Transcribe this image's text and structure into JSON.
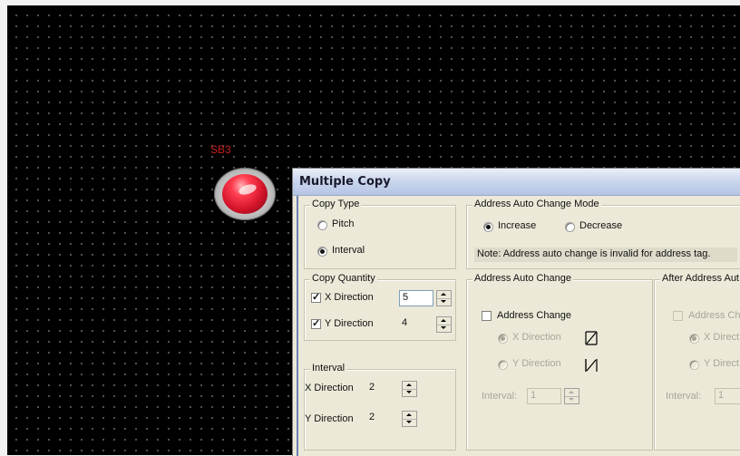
{
  "canvas": {
    "tag_label": "SB3"
  },
  "dialog": {
    "title": "Multiple Copy",
    "copy_type": {
      "legend": "Copy Type",
      "options": [
        "Pitch",
        "Interval"
      ],
      "selected": "Interval"
    },
    "copy_quantity": {
      "legend": "Copy Quantity",
      "x_label": "X Direction",
      "x_checked": true,
      "x_value": "5",
      "y_label": "Y Direction",
      "y_checked": true,
      "y_value": "4"
    },
    "interval": {
      "legend": "Interval",
      "x_label": "X Direction",
      "x_value": "2",
      "y_label": "Y Direction",
      "y_value": "2"
    },
    "address_mode": {
      "legend": "Address Auto Change Mode",
      "options": [
        "Increase",
        "Decrease"
      ],
      "selected": "Increase",
      "note": "Note: Address auto change is invalid for address tag."
    },
    "address_change": {
      "legend": "Address Auto Change",
      "checkbox_label": "Address Change",
      "checked": false,
      "x_option": "X Direction",
      "y_option": "Y Direction",
      "selected": "X Direction",
      "interval_label": "Interval:",
      "interval_value": "1"
    },
    "after_address": {
      "legend": "After Address Aut",
      "checkbox_label": "Address Cha",
      "x_option": "X Direct",
      "y_option": "Y Direct",
      "interval_label": "Interval:",
      "interval_value": "1"
    }
  }
}
